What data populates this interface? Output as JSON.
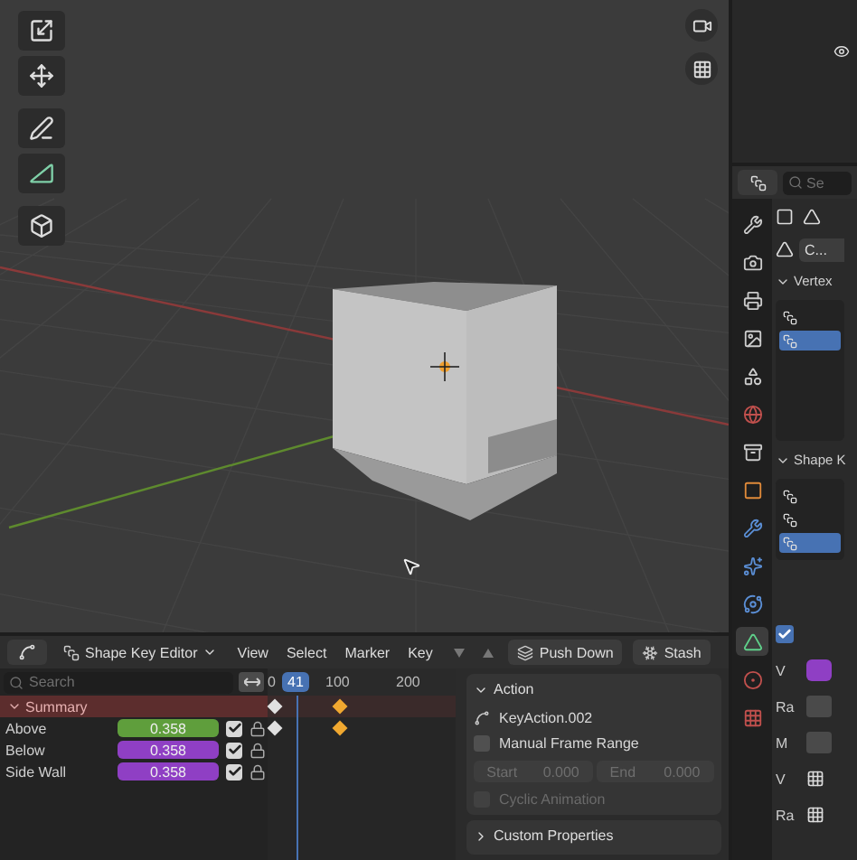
{
  "viewport": {
    "kind": "scene"
  },
  "editor": {
    "type_label": "Shape Key Editor",
    "menus": [
      "View",
      "Select",
      "Marker",
      "Key"
    ],
    "buttons": [
      {
        "label": "Push Down",
        "kind": "pushdown"
      },
      {
        "label": "Stash",
        "kind": "stash"
      }
    ]
  },
  "channels": {
    "search": {
      "placeholder": "Search"
    },
    "summary": {
      "label": "Summary",
      "expanded": true,
      "keyframes": [
        {
          "selected": false
        },
        {
          "selected": true
        }
      ]
    },
    "shape_keys": [
      {
        "name": "Above",
        "value": "0.358",
        "color": "#5f9e3c",
        "checked": true,
        "keyframes": [
          {
            "selected": false
          },
          {
            "selected": true
          }
        ]
      },
      {
        "name": "Below",
        "value": "0.358",
        "color": "#8f3fc4",
        "checked": true
      },
      {
        "name": "Side Wall",
        "value": "0.358",
        "color": "#8f3fc4",
        "checked": true
      }
    ]
  },
  "timeline": {
    "current_frame": "41",
    "ticks": [
      "0",
      "100",
      "200"
    ]
  },
  "sidebar": {
    "panels": [
      {
        "title": "Action",
        "expanded": true,
        "action_name": "KeyAction.002",
        "manual_frame_range": {
          "label": "Manual Frame Range",
          "checked": false
        },
        "range": [
          {
            "label": "Start",
            "value": "0.000",
            "disabled": true
          },
          {
            "label": "End",
            "value": "0.000",
            "disabled": true
          }
        ],
        "cyclic": {
          "label": "Cyclic Animation",
          "checked": false,
          "disabled": true
        }
      },
      {
        "title": "Custom Properties",
        "expanded": false
      }
    ]
  },
  "properties": {
    "search": {
      "placeholder": "Se"
    },
    "mesh_name": "C...",
    "tabs": [
      {
        "kind": "tool",
        "selected": false
      },
      {
        "kind": "render",
        "selected": false
      },
      {
        "kind": "output",
        "selected": false
      },
      {
        "kind": "view",
        "selected": false
      },
      {
        "kind": "scene",
        "selected": false
      },
      {
        "kind": "world",
        "selected": false
      },
      {
        "kind": "collection",
        "selected": false
      },
      {
        "kind": "object",
        "selected": false
      },
      {
        "kind": "modifier",
        "selected": false
      },
      {
        "kind": "particles",
        "selected": false
      },
      {
        "kind": "physics",
        "selected": false
      },
      {
        "kind": "data",
        "selected": true
      },
      {
        "kind": "material",
        "selected": false
      },
      {
        "kind": "texture",
        "selected": false
      }
    ],
    "panels": [
      {
        "title": "Vertex",
        "expanded": true,
        "items": [
          {
            "selected": false
          },
          {
            "selected": true
          }
        ]
      },
      {
        "title": "Shape K",
        "expanded": true,
        "items": [
          {
            "selected": false
          },
          {
            "selected": false
          },
          {
            "selected": true
          }
        ]
      }
    ],
    "lower": {
      "checked": true,
      "rows": [
        {
          "label": "V",
          "kind": "swatch"
        },
        {
          "label": "Ra",
          "kind": "field"
        },
        {
          "label": "M",
          "kind": "field"
        },
        {
          "label": "V",
          "kind": "icon"
        },
        {
          "label": "Ra",
          "kind": "icon"
        }
      ]
    }
  }
}
